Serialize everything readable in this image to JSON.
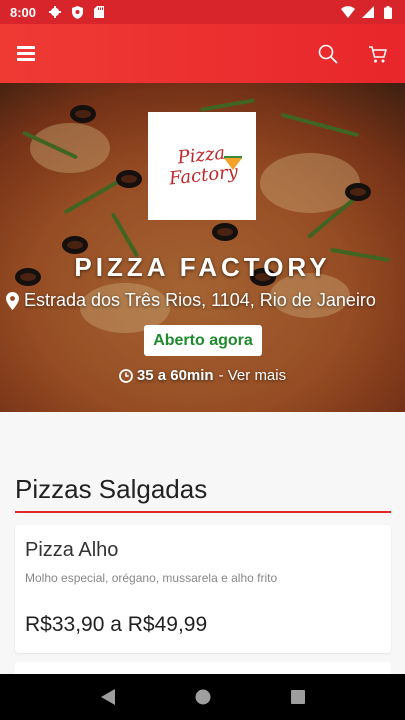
{
  "status_bar": {
    "time": "8:00",
    "left_icons": [
      "gear-icon",
      "shield-icon",
      "sd-card-icon"
    ],
    "right_icons": [
      "wifi-icon",
      "signal-icon",
      "battery-icon"
    ]
  },
  "app_bar": {
    "menu_icon": "hamburger-menu-icon",
    "search_icon": "search-icon",
    "cart_icon": "cart-icon",
    "color": "#e8262b"
  },
  "store": {
    "logo_line1": "Pizza",
    "logo_line2": "Factory",
    "name": "PIZZA FACTORY",
    "address": "Estrada dos Três Rios, 1104, Rio de Janeiro",
    "status": "Aberto agora",
    "delivery_time": "35 a 60min",
    "see_more": "- Ver mais",
    "status_color": "#1f8a2e"
  },
  "menu": {
    "section_title": "Pizzas Salgadas",
    "items": [
      {
        "name": "Pizza Alho",
        "description": "Molho especial, orégano, mussarela e alho frito",
        "price": "R$33,90 a R$49,99"
      }
    ]
  },
  "nav_bar": {
    "back_icon": "back-triangle-icon",
    "home_icon": "home-circle-icon",
    "recents_icon": "recents-square-icon"
  }
}
